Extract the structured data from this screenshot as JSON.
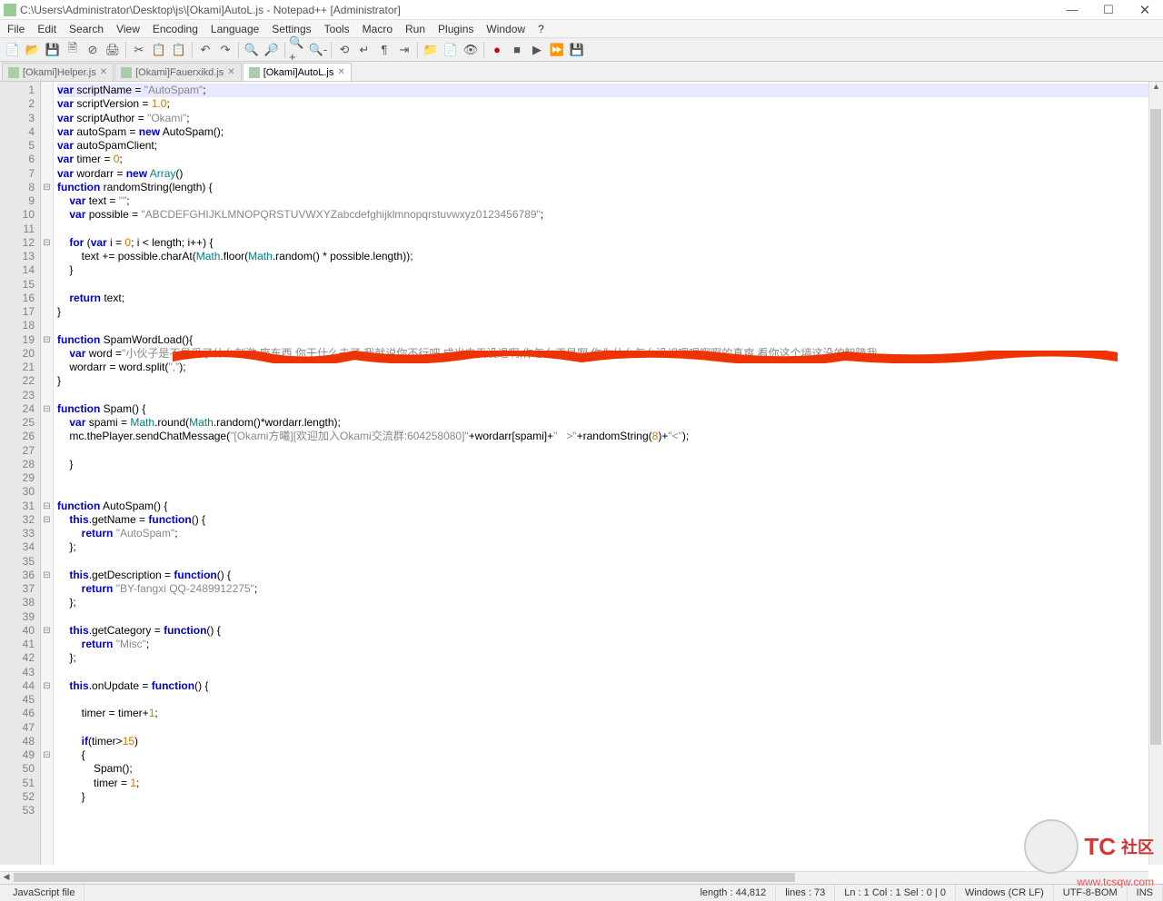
{
  "window": {
    "title": "C:\\Users\\Administrator\\Desktop\\js\\[Okami]AutoL.js - Notepad++ [Administrator]"
  },
  "menu": [
    "File",
    "Edit",
    "Search",
    "View",
    "Encoding",
    "Language",
    "Settings",
    "Tools",
    "Macro",
    "Run",
    "Plugins",
    "Window",
    "?"
  ],
  "tabs": [
    {
      "label": "[Okami]Helper.js",
      "active": false
    },
    {
      "label": "[Okami]Fauerxikd.js",
      "active": false
    },
    {
      "label": "[Okami]AutoL.js",
      "active": true
    }
  ],
  "code": {
    "lines": [
      {
        "n": 1,
        "fold": "",
        "hl": true,
        "html": "<span class='k'>var</span> scriptName = <span class='s'>\"AutoSpam\"</span>;"
      },
      {
        "n": 2,
        "fold": "",
        "html": "<span class='k'>var</span> scriptVersion = <span class='n'>1.0</span>;"
      },
      {
        "n": 3,
        "fold": "",
        "html": "<span class='k'>var</span> scriptAuthor = <span class='s'>\"Okami\"</span>;"
      },
      {
        "n": 4,
        "fold": "",
        "html": "<span class='k'>var</span> autoSpam = <span class='k'>new</span> AutoSpam();"
      },
      {
        "n": 5,
        "fold": "",
        "html": "<span class='k'>var</span> autoSpamClient;"
      },
      {
        "n": 6,
        "fold": "",
        "html": "<span class='k'>var</span> timer = <span class='n'>0</span>;"
      },
      {
        "n": 7,
        "fold": "",
        "html": "<span class='k'>var</span> wordarr = <span class='k'>new</span> <span class='m'>Array</span>()"
      },
      {
        "n": 8,
        "fold": "⊟",
        "html": "<span class='k'>function</span> randomString(length) {"
      },
      {
        "n": 9,
        "fold": "",
        "html": "    <span class='k'>var</span> text = <span class='s'>\"\"</span>;"
      },
      {
        "n": 10,
        "fold": "",
        "html": "    <span class='k'>var</span> possible = <span class='s'>\"ABCDEFGHIJKLMNOPQRSTUVWXYZabcdefghijklmnopqrstuvwxyz0123456789\"</span>;"
      },
      {
        "n": 11,
        "fold": "",
        "html": ""
      },
      {
        "n": 12,
        "fold": "⊟",
        "html": "    <span class='k'>for</span> (<span class='k'>var</span> i = <span class='n'>0</span>; i &lt; length; i++) {"
      },
      {
        "n": 13,
        "fold": "",
        "html": "        text += possible.charAt(<span class='m'>Math</span>.floor(<span class='m'>Math</span>.random() * possible.length));"
      },
      {
        "n": 14,
        "fold": "",
        "html": "    }"
      },
      {
        "n": 15,
        "fold": "",
        "html": ""
      },
      {
        "n": 16,
        "fold": "",
        "html": "    <span class='k'>return</span> text;"
      },
      {
        "n": 17,
        "fold": "",
        "html": "}"
      },
      {
        "n": 18,
        "fold": "",
        "html": ""
      },
      {
        "n": 19,
        "fold": "⊟",
        "html": "<span class='k'>function</span> SpamWordLoad(){"
      },
      {
        "n": 20,
        "fold": "",
        "html": "    <span class='k'>var</span> word =<span class='s'>\"小伙子是不是受了什么刺激,废东西,你干什么去了,我就说你不行吧,成米虫天没退啊,你怎么不是啊,你为什么怎么没识嗯嗯啊啊的真爽,看你这个墙这没的智障我</span>"
      },
      {
        "n": 21,
        "fold": "",
        "html": "    wordarr = word.split(<span class='s'>\",\"</span>);"
      },
      {
        "n": 22,
        "fold": "",
        "html": "}"
      },
      {
        "n": 23,
        "fold": "",
        "html": ""
      },
      {
        "n": 24,
        "fold": "⊟",
        "html": "<span class='k'>function</span> Spam() {"
      },
      {
        "n": 25,
        "fold": "",
        "html": "    <span class='k'>var</span> spami = <span class='m'>Math</span>.round(<span class='m'>Math</span>.random()*wordarr.length);"
      },
      {
        "n": 26,
        "fold": "",
        "html": "    mc.thePlayer.sendChatMessage(<span class='s'>\"[Okami方曦][欢迎加入Okami交流群:604258080]\"</span>+wordarr[spami]+<span class='s'>\"   &gt;\"</span>+randomString(<span class='n'>8</span>)+<span class='s'>\"&lt;\"</span>);"
      },
      {
        "n": 27,
        "fold": "",
        "html": ""
      },
      {
        "n": 28,
        "fold": "",
        "html": "    }"
      },
      {
        "n": 29,
        "fold": "",
        "html": ""
      },
      {
        "n": 30,
        "fold": "",
        "html": ""
      },
      {
        "n": 31,
        "fold": "⊟",
        "html": "<span class='k'>function</span> AutoSpam() {"
      },
      {
        "n": 32,
        "fold": "⊟",
        "html": "    <span class='k'>this</span>.getName = <span class='k'>function</span>() {"
      },
      {
        "n": 33,
        "fold": "",
        "html": "        <span class='k'>return</span> <span class='s'>\"AutoSpam\"</span>;"
      },
      {
        "n": 34,
        "fold": "",
        "html": "    };"
      },
      {
        "n": 35,
        "fold": "",
        "html": ""
      },
      {
        "n": 36,
        "fold": "⊟",
        "html": "    <span class='k'>this</span>.getDescription = <span class='k'>function</span>() {"
      },
      {
        "n": 37,
        "fold": "",
        "html": "        <span class='k'>return</span> <span class='s'>\"BY-fangxi QQ-2489912275\"</span>;"
      },
      {
        "n": 38,
        "fold": "",
        "html": "    };"
      },
      {
        "n": 39,
        "fold": "",
        "html": ""
      },
      {
        "n": 40,
        "fold": "⊟",
        "html": "    <span class='k'>this</span>.getCategory = <span class='k'>function</span>() {"
      },
      {
        "n": 41,
        "fold": "",
        "html": "        <span class='k'>return</span> <span class='s'>\"Misc\"</span>;"
      },
      {
        "n": 42,
        "fold": "",
        "html": "    };"
      },
      {
        "n": 43,
        "fold": "",
        "html": ""
      },
      {
        "n": 44,
        "fold": "⊟",
        "html": "    <span class='k'>this</span>.onUpdate = <span class='k'>function</span>() {"
      },
      {
        "n": 45,
        "fold": "",
        "html": ""
      },
      {
        "n": 46,
        "fold": "",
        "html": "        timer = timer+<span class='n'>1</span>;"
      },
      {
        "n": 47,
        "fold": "",
        "html": ""
      },
      {
        "n": 48,
        "fold": "",
        "html": "        <span class='k'>if</span>(timer&gt;<span class='n'>15</span>)"
      },
      {
        "n": 49,
        "fold": "⊟",
        "html": "        {"
      },
      {
        "n": 50,
        "fold": "",
        "html": "            Spam();"
      },
      {
        "n": 51,
        "fold": "",
        "html": "            timer = <span class='n'>1</span>;"
      },
      {
        "n": 52,
        "fold": "",
        "html": "        }"
      },
      {
        "n": 53,
        "fold": "",
        "html": ""
      }
    ]
  },
  "status": {
    "filetype": "JavaScript file",
    "length": "length : 44,812",
    "lines": "lines : 73",
    "pos": "Ln : 1    Col : 1    Sel : 0 | 0",
    "eol": "Windows (CR LF)",
    "enc": "UTF-8-BOM",
    "mode": "INS"
  },
  "watermark": {
    "brand": "TC",
    "sub": "社区",
    "url": "www.tcsqw.com"
  }
}
